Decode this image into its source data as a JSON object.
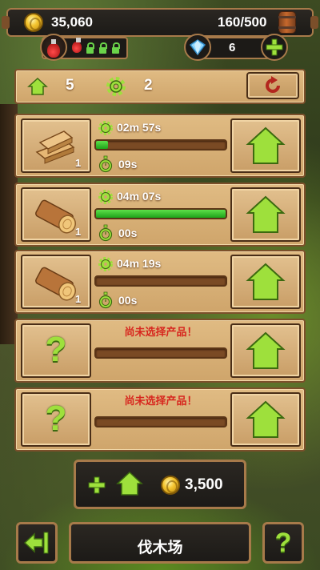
{
  "hud": {
    "coins": "35,060",
    "storage": "160/500",
    "gems": "6"
  },
  "status": {
    "workers": "5",
    "upgrades": "2"
  },
  "production_rows": [
    {
      "item_icon": "wood-planks-icon",
      "count": "1",
      "total_time": "02m 57s",
      "progress": 0.09,
      "remaining": "09s"
    },
    {
      "item_icon": "log-icon",
      "count": "1",
      "total_time": "04m 07s",
      "progress": 1.0,
      "remaining": "00s"
    },
    {
      "item_icon": "log-icon",
      "count": "1",
      "total_time": "04m 19s",
      "progress": 0.0,
      "remaining": "00s"
    },
    {
      "item_icon": "question-icon",
      "message": "尚未选择产品！",
      "progress": 0.0
    },
    {
      "item_icon": "question-icon",
      "message": "尚未选择产品！",
      "progress": 0.0
    }
  ],
  "buy_slot": {
    "price": "3,500"
  },
  "footer": {
    "title": "伐木场"
  },
  "colors": {
    "accent_green": "#9ee03c",
    "panel_brown": "#cfa56b",
    "warning_red": "#d7261e"
  }
}
